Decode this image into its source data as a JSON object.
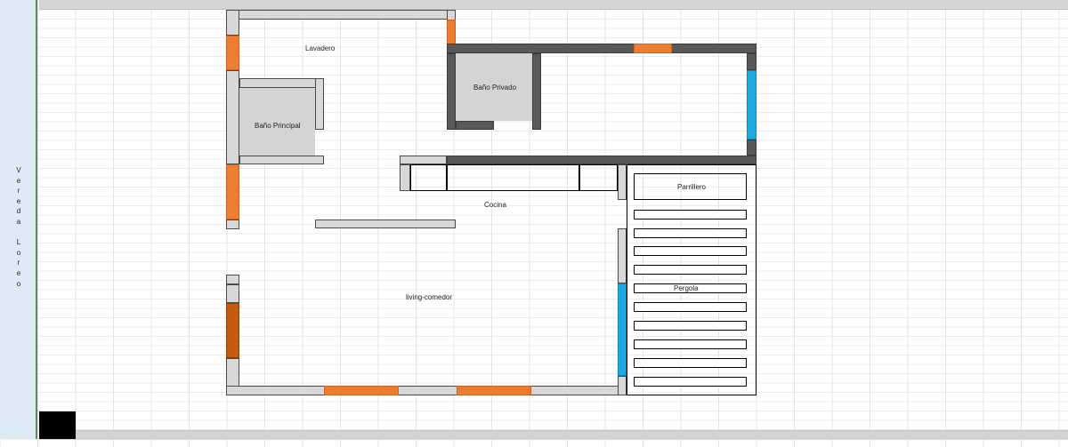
{
  "street_label": "Vereda Loreo",
  "rooms": {
    "lavadero": "Lavadero",
    "bano_privado": "Baño Privado",
    "bano_principal": "Baño Principal",
    "cocina": "Cocina",
    "living_comedor": "living-comedor",
    "parrillero": "Parrillero",
    "pergola": "Pergola"
  },
  "colors": {
    "interior_wall": "#d8d8d8",
    "exterior_wall": "#595959",
    "window": "#ed7d31",
    "door": "#c55a11",
    "glass": "#1fa7e0"
  }
}
